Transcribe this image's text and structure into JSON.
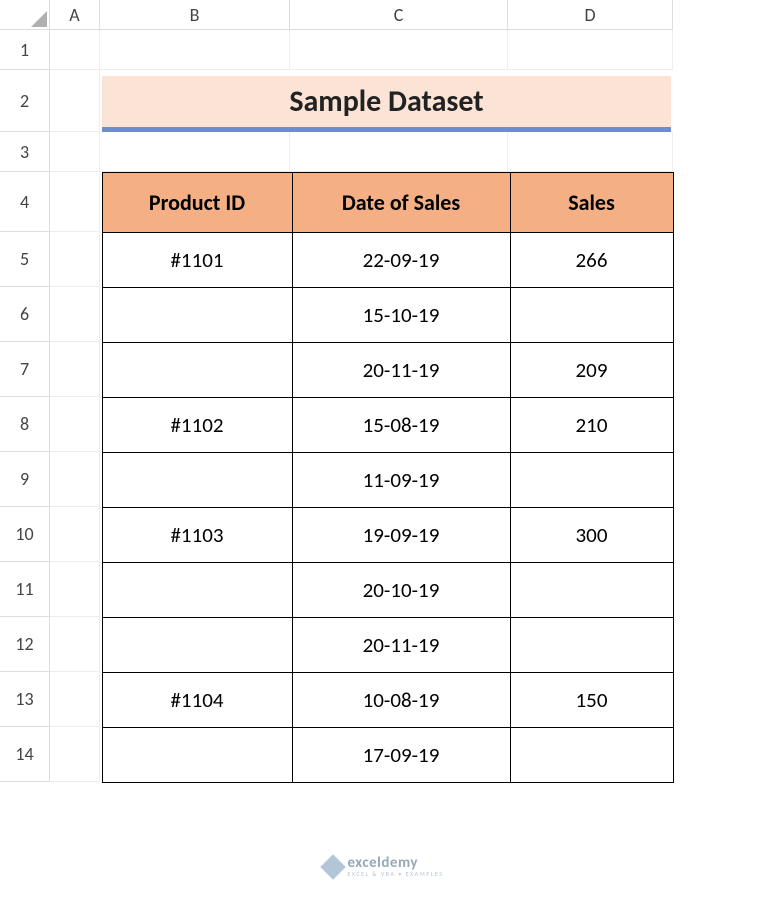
{
  "columns": [
    "A",
    "B",
    "C",
    "D"
  ],
  "rows": [
    "1",
    "2",
    "3",
    "4",
    "5",
    "6",
    "7",
    "8",
    "9",
    "10",
    "11",
    "12",
    "13",
    "14"
  ],
  "title": "Sample Dataset",
  "table": {
    "headers": {
      "b": "Product ID",
      "c": "Date of Sales",
      "d": "Sales"
    },
    "rows": [
      {
        "b": "#1101",
        "c": "22-09-19",
        "d": "266"
      },
      {
        "b": "",
        "c": "15-10-19",
        "d": ""
      },
      {
        "b": "",
        "c": "20-11-19",
        "d": "209"
      },
      {
        "b": "#1102",
        "c": "15-08-19",
        "d": "210"
      },
      {
        "b": "",
        "c": "11-09-19",
        "d": ""
      },
      {
        "b": "#1103",
        "c": "19-09-19",
        "d": "300"
      },
      {
        "b": "",
        "c": "20-10-19",
        "d": ""
      },
      {
        "b": "",
        "c": "20-11-19",
        "d": ""
      },
      {
        "b": "#1104",
        "c": "10-08-19",
        "d": "150"
      },
      {
        "b": "",
        "c": "17-09-19",
        "d": ""
      }
    ]
  },
  "watermark": {
    "main": "exceldemy",
    "sub": "EXCEL & VBA • EXAMPLES"
  }
}
